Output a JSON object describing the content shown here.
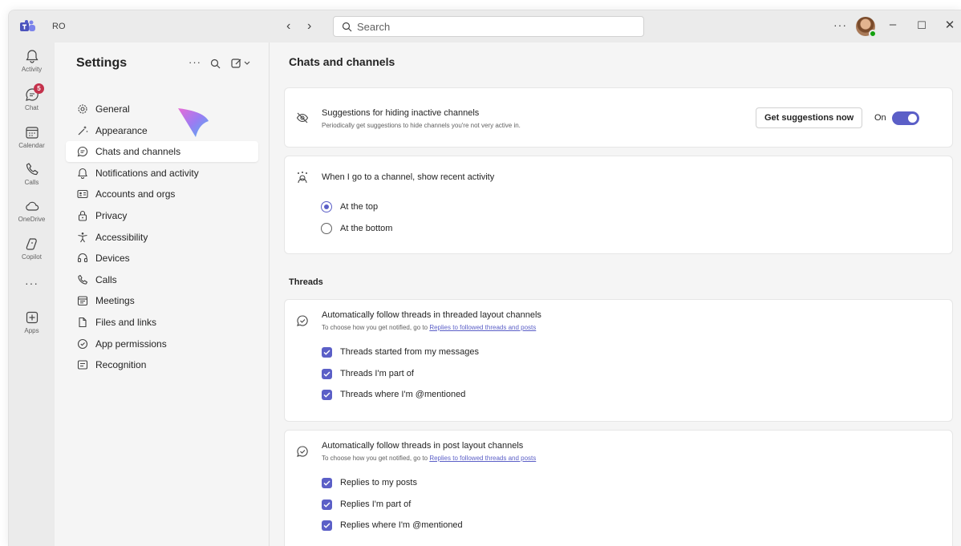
{
  "titlebar": {
    "initials": "RO",
    "back_glyph": "‹",
    "forward_glyph": "›",
    "search_placeholder": "Search",
    "more_glyph": "···",
    "minimize_glyph": "–",
    "maximize_glyph": "☐",
    "close_glyph": "✕"
  },
  "rail": {
    "activity": "Activity",
    "chat": "Chat",
    "chat_badge": "5",
    "calendar": "Calendar",
    "calls": "Calls",
    "onedrive": "OneDrive",
    "copilot": "Copilot",
    "more": "···",
    "apps": "Apps"
  },
  "settings": {
    "title": "Settings",
    "more_glyph": "···",
    "items": [
      {
        "label": "General",
        "icon": "gear-icon"
      },
      {
        "label": "Appearance",
        "icon": "wand-icon"
      },
      {
        "label": "Chats and channels",
        "icon": "chat-icon"
      },
      {
        "label": "Notifications and activity",
        "icon": "bell-icon"
      },
      {
        "label": "Accounts and orgs",
        "icon": "contact-card-icon"
      },
      {
        "label": "Privacy",
        "icon": "lock-icon"
      },
      {
        "label": "Accessibility",
        "icon": "accessibility-icon"
      },
      {
        "label": "Devices",
        "icon": "headset-icon"
      },
      {
        "label": "Calls",
        "icon": "phone-icon"
      },
      {
        "label": "Meetings",
        "icon": "calendar-icon"
      },
      {
        "label": "Files and links",
        "icon": "document-icon"
      },
      {
        "label": "App permissions",
        "icon": "shield-icon"
      },
      {
        "label": "Recognition",
        "icon": "id-card-icon"
      }
    ],
    "active_index": 2
  },
  "main": {
    "title": "Chats and channels",
    "suggestions": {
      "title": "Suggestions for hiding inactive channels",
      "subtitle": "Periodically get suggestions to hide channels you're not very active in.",
      "button": "Get suggestions now",
      "toggle_label": "On",
      "toggle_on": true
    },
    "recent_activity": {
      "title": "When I go to a channel, show recent activity",
      "options": [
        {
          "label": "At the top",
          "checked": true
        },
        {
          "label": "At the bottom",
          "checked": false
        }
      ]
    },
    "threads_heading": "Threads",
    "threaded": {
      "title": "Automatically follow threads in threaded layout channels",
      "subtitle_prefix": "To choose how you get notified, go to ",
      "subtitle_link": "Replies to followed threads and posts",
      "options": [
        {
          "label": "Threads started from my messages",
          "checked": true
        },
        {
          "label": "Threads I'm part of",
          "checked": true
        },
        {
          "label": "Threads where I'm @mentioned",
          "checked": true
        }
      ]
    },
    "post": {
      "title": "Automatically follow threads in post layout channels",
      "subtitle_prefix": "To choose how you get notified, go to ",
      "subtitle_link": "Replies to followed threads and posts",
      "options": [
        {
          "label": "Replies to my posts",
          "checked": true
        },
        {
          "label": "Replies I'm part of",
          "checked": true
        },
        {
          "label": "Replies where I'm @mentioned",
          "checked": true
        }
      ]
    }
  },
  "colors": {
    "accent": "#5b5fc7",
    "badge": "#c4314b",
    "presence": "#13a10e"
  }
}
